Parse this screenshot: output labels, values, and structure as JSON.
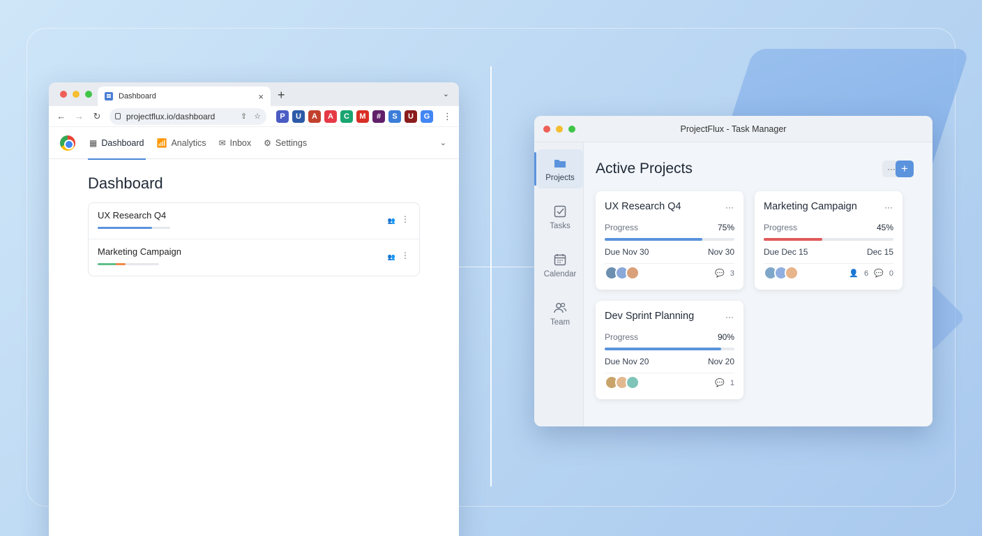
{
  "browser": {
    "tab_title": "Dashboard",
    "tab_close": "×",
    "new_tab": "+",
    "tab_chevron": "⌄",
    "url": "projectflux.io/dashboard",
    "extensions": [
      {
        "icon": "P",
        "color": "#4a5cc4"
      },
      {
        "icon": "U",
        "color": "#2c5aa8"
      },
      {
        "icon": "A",
        "color": "#c2412e"
      },
      {
        "icon": "A",
        "color": "#e63946"
      },
      {
        "icon": "C",
        "color": "#1aa571"
      },
      {
        "icon": "M",
        "color": "#d93025"
      },
      {
        "icon": "#",
        "color": "#611f69"
      },
      {
        "icon": "S",
        "color": "#3b7dd8"
      },
      {
        "icon": "U",
        "color": "#8b1c1c"
      },
      {
        "icon": "G",
        "color": "#4285f4"
      }
    ]
  },
  "nav": {
    "items": [
      {
        "label": "Dashboard",
        "icon": "▦",
        "active": true
      },
      {
        "label": "Analytics",
        "icon": "📶",
        "active": false
      },
      {
        "label": "Inbox",
        "icon": "✉",
        "active": false
      },
      {
        "label": "Settings",
        "icon": "⚙",
        "active": false
      }
    ]
  },
  "dashboard": {
    "title": "Dashboard",
    "rows": [
      {
        "name": "UX Research Q4",
        "progress": 0.75,
        "color": "#5b93dd"
      },
      {
        "name": "Marketing Campaign",
        "progress": 0.45,
        "color": "#5fbf8a",
        "color2": "#f08a4b"
      }
    ]
  },
  "app": {
    "window_title": "ProjectFlux - Task Manager",
    "sidebar": [
      {
        "label": "Projects",
        "icon": "folder-icon",
        "active": true
      },
      {
        "label": "Tasks",
        "icon": "checkbox-icon",
        "active": false
      },
      {
        "label": "Calendar",
        "icon": "calendar-icon",
        "active": false
      },
      {
        "label": "Team",
        "icon": "team-icon",
        "active": false
      }
    ],
    "title": "Active Projects",
    "more_label": "···",
    "add_label": "+",
    "cards": [
      {
        "title": "UX Research Q4",
        "progress_label": "Progress",
        "progress_text": "75%",
        "progress": 0.75,
        "bar_color": "#5b93dd",
        "due": "Due Nov 30",
        "due_short": "Nov 30",
        "comments": "3",
        "members": ""
      },
      {
        "title": "Marketing Campaign",
        "progress_label": "Progress",
        "progress_text": "45%",
        "progress": 0.45,
        "bar_color": "#e05a5a",
        "due": "Due Dec 15",
        "due_short": "Dec 15",
        "comments": "0",
        "members": "6"
      },
      {
        "title": "Dev Sprint Planning",
        "progress_label": "Progress",
        "progress_text": "90%",
        "progress": 0.9,
        "bar_color": "#5b93dd",
        "due": "Due Nov 20",
        "due_short": "Nov 20",
        "comments": "1",
        "members": ""
      }
    ]
  }
}
